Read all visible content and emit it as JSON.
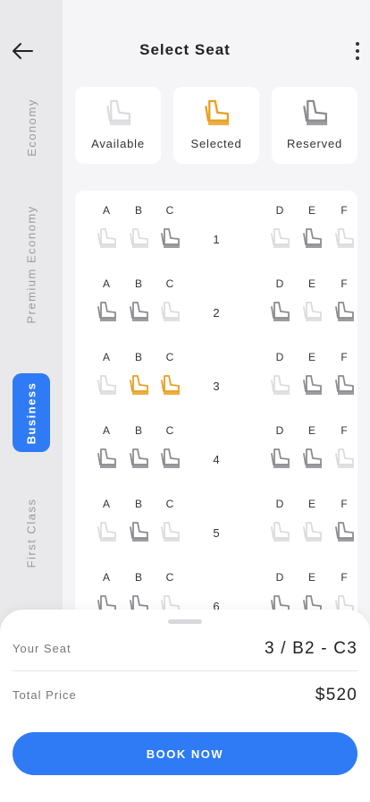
{
  "header": {
    "title": "Select Seat",
    "back_icon": "arrow-left-icon",
    "menu_icon": "more-vertical-icon"
  },
  "sidebar": {
    "items": [
      {
        "label": "Economy",
        "active": false
      },
      {
        "label": "Premium Economy",
        "active": false
      },
      {
        "label": "Business",
        "active": true
      },
      {
        "label": "First Class",
        "active": false
      }
    ]
  },
  "legend": [
    {
      "label": "Available",
      "state": "available"
    },
    {
      "label": "Selected",
      "state": "selected"
    },
    {
      "label": "Reserved",
      "state": "reserved"
    }
  ],
  "colors": {
    "accent": "#2f7bf5",
    "selected": "#e8a020",
    "reserved": "#8c8c90",
    "available": "#dcdcdf"
  },
  "seatmap": {
    "columns_left": [
      "A",
      "B",
      "C"
    ],
    "columns_right": [
      "D",
      "E",
      "F"
    ],
    "rows": [
      {
        "number": "1",
        "left": [
          "available",
          "available",
          "reserved"
        ],
        "right": [
          "available",
          "reserved",
          "available"
        ]
      },
      {
        "number": "2",
        "left": [
          "reserved",
          "reserved",
          "available"
        ],
        "right": [
          "reserved",
          "available",
          "reserved"
        ]
      },
      {
        "number": "3",
        "left": [
          "available",
          "selected",
          "selected"
        ],
        "right": [
          "available",
          "reserved",
          "reserved"
        ]
      },
      {
        "number": "4",
        "left": [
          "reserved",
          "reserved",
          "reserved"
        ],
        "right": [
          "reserved",
          "reserved",
          "available"
        ]
      },
      {
        "number": "5",
        "left": [
          "available",
          "reserved",
          "available"
        ],
        "right": [
          "available",
          "available",
          "reserved"
        ]
      },
      {
        "number": "6",
        "left": [
          "reserved",
          "reserved",
          "available"
        ],
        "right": [
          "reserved",
          "reserved",
          "available"
        ]
      }
    ]
  },
  "summary": {
    "seat_label": "Your Seat",
    "seat_value": "3 / B2 - C3",
    "price_label": "Total Price",
    "price_value": "$520",
    "book_label": "BOOK NOW"
  }
}
